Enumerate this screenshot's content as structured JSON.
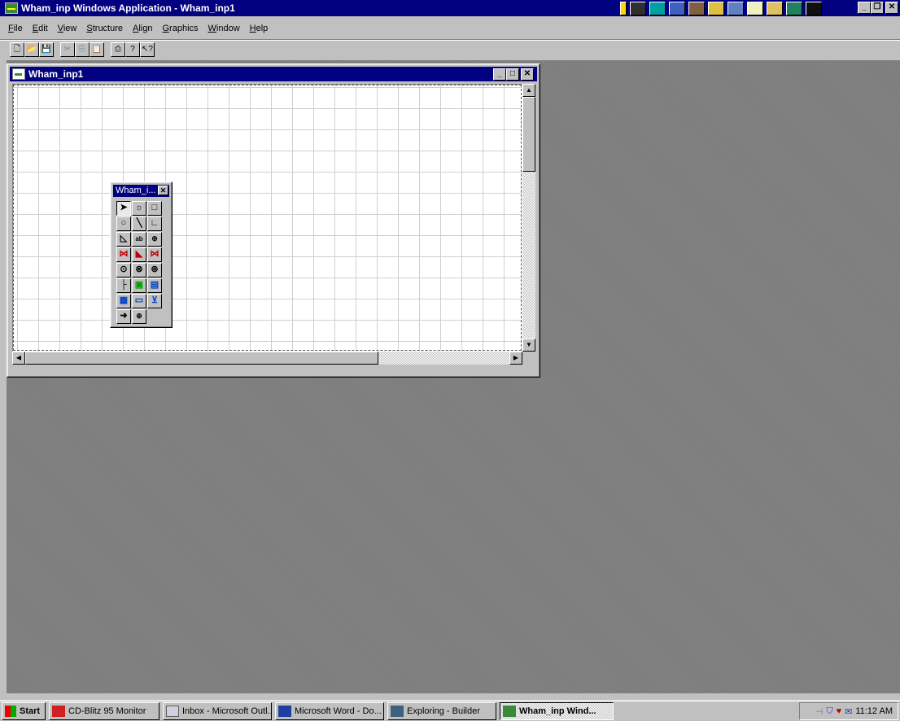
{
  "app": {
    "title": "Wham_inp Windows Application - Wham_inp1"
  },
  "menu": [
    {
      "label": "File",
      "access": "F",
      "rest": "ile"
    },
    {
      "label": "Edit",
      "access": "E",
      "rest": "dit"
    },
    {
      "label": "View",
      "access": "V",
      "rest": "iew"
    },
    {
      "label": "Structure",
      "access": "S",
      "rest": "tructure"
    },
    {
      "label": "Align",
      "access": "A",
      "rest": "lign"
    },
    {
      "label": "Graphics",
      "access": "G",
      "rest": "raphics"
    },
    {
      "label": "Window",
      "access": "W",
      "rest": "indow"
    },
    {
      "label": "Help",
      "access": "H",
      "rest": "elp"
    }
  ],
  "toolbar": {
    "new_icon": "new-document-icon",
    "open_icon": "open-folder-icon",
    "save_icon": "save-disk-icon",
    "cut_icon": "cut-icon",
    "copy_icon": "copy-icon",
    "paste_icon": "paste-icon",
    "print_icon": "printer-icon",
    "about_icon": "help-question-icon",
    "context_help_icon": "context-help-icon"
  },
  "child_window": {
    "title": "Wham_inp1"
  },
  "palette": {
    "title": "Wham_i..."
  },
  "taskbar": {
    "start": "Start",
    "tasks": [
      {
        "label": "CD-Blitz 95 Monitor"
      },
      {
        "label": "Inbox - Microsoft Outl..."
      },
      {
        "label": "Microsoft Word - Do..."
      },
      {
        "label": "Exploring - Builder"
      },
      {
        "label": "Wham_inp Wind..."
      }
    ],
    "clock": "11:12 AM"
  },
  "colors": {
    "title_bar": "#000080",
    "desktop": "#808080",
    "face": "#c0c0c0"
  }
}
